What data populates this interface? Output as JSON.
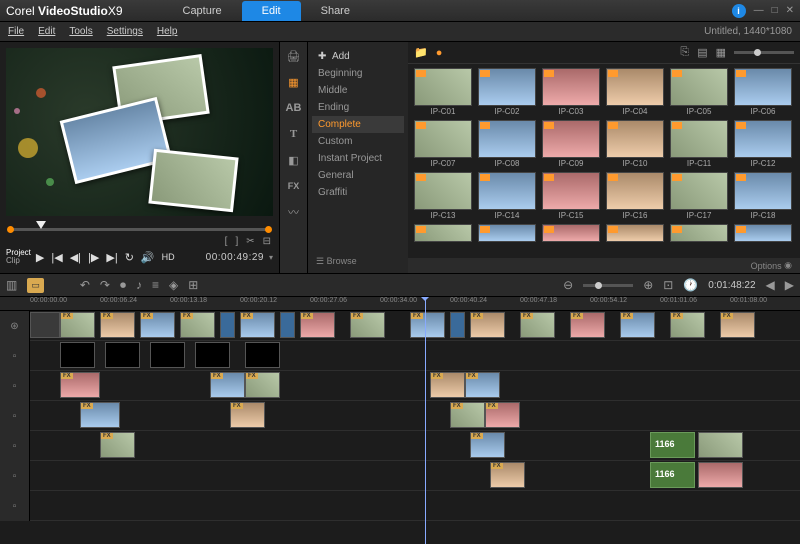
{
  "brand": {
    "prefix": "Corel",
    "name": "VideoStudio",
    "version": "X9"
  },
  "tabs": {
    "capture": "Capture",
    "edit": "Edit",
    "share": "Share"
  },
  "doc_title": "Untitled, 1440*1080",
  "menu": {
    "file": "File",
    "edit": "Edit",
    "tools": "Tools",
    "settings": "Settings",
    "help": "Help"
  },
  "transport": {
    "project": "Project",
    "clip": "Clip",
    "hd": "HD",
    "timecode": "00:00:49:29"
  },
  "categories": {
    "add": "Add",
    "items": [
      "Beginning",
      "Middle",
      "Ending",
      "Complete",
      "Custom",
      "Instant Project",
      "General",
      "Graffiti"
    ],
    "selected": "Complete",
    "browse": "Browse"
  },
  "library": {
    "options": "Options",
    "rows": [
      [
        "IP-C01",
        "IP-C02",
        "IP-C03",
        "IP-C04",
        "IP-C05",
        "IP-C06"
      ],
      [
        "IP-C07",
        "IP-C08",
        "IP-C09",
        "IP-C10",
        "IP-C11",
        "IP-C12"
      ],
      [
        "IP-C13",
        "IP-C14",
        "IP-C15",
        "IP-C16",
        "IP-C17",
        "IP-C18"
      ]
    ]
  },
  "timeline": {
    "timecode": "0:01:48:22",
    "ruler": [
      "00:00:00.00",
      "00:00:06.24",
      "00:00:13.18",
      "00:00:20.12",
      "00:00:27.06",
      "00:00:34.00",
      "00:00:40.24",
      "00:00:47.18",
      "00:00:54.12",
      "00:01:01.06",
      "00:01:08.00"
    ],
    "clip_green": "1166"
  },
  "fx": "FX"
}
